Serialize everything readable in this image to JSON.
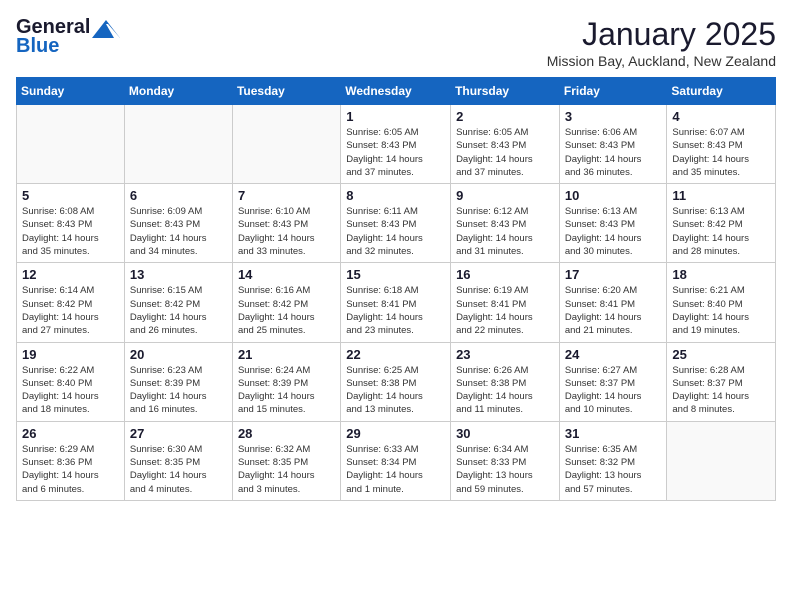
{
  "header": {
    "logo_general": "General",
    "logo_blue": "Blue",
    "month_title": "January 2025",
    "location": "Mission Bay, Auckland, New Zealand"
  },
  "weekdays": [
    "Sunday",
    "Monday",
    "Tuesday",
    "Wednesday",
    "Thursday",
    "Friday",
    "Saturday"
  ],
  "weeks": [
    [
      {
        "day": "",
        "info": ""
      },
      {
        "day": "",
        "info": ""
      },
      {
        "day": "",
        "info": ""
      },
      {
        "day": "1",
        "info": "Sunrise: 6:05 AM\nSunset: 8:43 PM\nDaylight: 14 hours\nand 37 minutes."
      },
      {
        "day": "2",
        "info": "Sunrise: 6:05 AM\nSunset: 8:43 PM\nDaylight: 14 hours\nand 37 minutes."
      },
      {
        "day": "3",
        "info": "Sunrise: 6:06 AM\nSunset: 8:43 PM\nDaylight: 14 hours\nand 36 minutes."
      },
      {
        "day": "4",
        "info": "Sunrise: 6:07 AM\nSunset: 8:43 PM\nDaylight: 14 hours\nand 35 minutes."
      }
    ],
    [
      {
        "day": "5",
        "info": "Sunrise: 6:08 AM\nSunset: 8:43 PM\nDaylight: 14 hours\nand 35 minutes."
      },
      {
        "day": "6",
        "info": "Sunrise: 6:09 AM\nSunset: 8:43 PM\nDaylight: 14 hours\nand 34 minutes."
      },
      {
        "day": "7",
        "info": "Sunrise: 6:10 AM\nSunset: 8:43 PM\nDaylight: 14 hours\nand 33 minutes."
      },
      {
        "day": "8",
        "info": "Sunrise: 6:11 AM\nSunset: 8:43 PM\nDaylight: 14 hours\nand 32 minutes."
      },
      {
        "day": "9",
        "info": "Sunrise: 6:12 AM\nSunset: 8:43 PM\nDaylight: 14 hours\nand 31 minutes."
      },
      {
        "day": "10",
        "info": "Sunrise: 6:13 AM\nSunset: 8:43 PM\nDaylight: 14 hours\nand 30 minutes."
      },
      {
        "day": "11",
        "info": "Sunrise: 6:13 AM\nSunset: 8:42 PM\nDaylight: 14 hours\nand 28 minutes."
      }
    ],
    [
      {
        "day": "12",
        "info": "Sunrise: 6:14 AM\nSunset: 8:42 PM\nDaylight: 14 hours\nand 27 minutes."
      },
      {
        "day": "13",
        "info": "Sunrise: 6:15 AM\nSunset: 8:42 PM\nDaylight: 14 hours\nand 26 minutes."
      },
      {
        "day": "14",
        "info": "Sunrise: 6:16 AM\nSunset: 8:42 PM\nDaylight: 14 hours\nand 25 minutes."
      },
      {
        "day": "15",
        "info": "Sunrise: 6:18 AM\nSunset: 8:41 PM\nDaylight: 14 hours\nand 23 minutes."
      },
      {
        "day": "16",
        "info": "Sunrise: 6:19 AM\nSunset: 8:41 PM\nDaylight: 14 hours\nand 22 minutes."
      },
      {
        "day": "17",
        "info": "Sunrise: 6:20 AM\nSunset: 8:41 PM\nDaylight: 14 hours\nand 21 minutes."
      },
      {
        "day": "18",
        "info": "Sunrise: 6:21 AM\nSunset: 8:40 PM\nDaylight: 14 hours\nand 19 minutes."
      }
    ],
    [
      {
        "day": "19",
        "info": "Sunrise: 6:22 AM\nSunset: 8:40 PM\nDaylight: 14 hours\nand 18 minutes."
      },
      {
        "day": "20",
        "info": "Sunrise: 6:23 AM\nSunset: 8:39 PM\nDaylight: 14 hours\nand 16 minutes."
      },
      {
        "day": "21",
        "info": "Sunrise: 6:24 AM\nSunset: 8:39 PM\nDaylight: 14 hours\nand 15 minutes."
      },
      {
        "day": "22",
        "info": "Sunrise: 6:25 AM\nSunset: 8:38 PM\nDaylight: 14 hours\nand 13 minutes."
      },
      {
        "day": "23",
        "info": "Sunrise: 6:26 AM\nSunset: 8:38 PM\nDaylight: 14 hours\nand 11 minutes."
      },
      {
        "day": "24",
        "info": "Sunrise: 6:27 AM\nSunset: 8:37 PM\nDaylight: 14 hours\nand 10 minutes."
      },
      {
        "day": "25",
        "info": "Sunrise: 6:28 AM\nSunset: 8:37 PM\nDaylight: 14 hours\nand 8 minutes."
      }
    ],
    [
      {
        "day": "26",
        "info": "Sunrise: 6:29 AM\nSunset: 8:36 PM\nDaylight: 14 hours\nand 6 minutes."
      },
      {
        "day": "27",
        "info": "Sunrise: 6:30 AM\nSunset: 8:35 PM\nDaylight: 14 hours\nand 4 minutes."
      },
      {
        "day": "28",
        "info": "Sunrise: 6:32 AM\nSunset: 8:35 PM\nDaylight: 14 hours\nand 3 minutes."
      },
      {
        "day": "29",
        "info": "Sunrise: 6:33 AM\nSunset: 8:34 PM\nDaylight: 14 hours\nand 1 minute."
      },
      {
        "day": "30",
        "info": "Sunrise: 6:34 AM\nSunset: 8:33 PM\nDaylight: 13 hours\nand 59 minutes."
      },
      {
        "day": "31",
        "info": "Sunrise: 6:35 AM\nSunset: 8:32 PM\nDaylight: 13 hours\nand 57 minutes."
      },
      {
        "day": "",
        "info": ""
      }
    ]
  ]
}
